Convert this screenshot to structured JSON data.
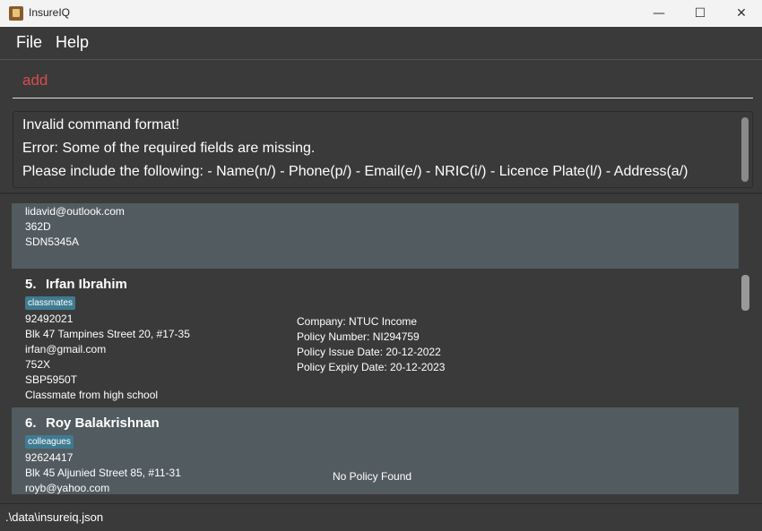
{
  "window": {
    "title": "InsureIQ",
    "minimize": "—",
    "maximize": "☐",
    "close": "✕"
  },
  "menu": {
    "file": "File",
    "help": "Help"
  },
  "command": {
    "value": "add"
  },
  "result": {
    "lines": [
      "Invalid command format!",
      "Error: Some of the required fields are missing.",
      "Please include the following: - Name(n/) - Phone(p/) - Email(e/) - NRIC(i/) - Licence Plate(l/) - Address(a/)"
    ]
  },
  "cards": [
    {
      "email": "lidavid@outlook.com",
      "nric": "362D",
      "plate": "SDN5345A"
    },
    {
      "index": "5.",
      "name": "Irfan Ibrahim",
      "tag": "classmates",
      "phone": "92492021",
      "address": "Blk 47 Tampines Street 20, #17-35",
      "email": "irfan@gmail.com",
      "nric": "752X",
      "plate": "SBP5950T",
      "remark": "Classmate from high school",
      "policy": {
        "company": "Company: NTUC Income",
        "number": "Policy Number: NI294759",
        "issue": "Policy Issue Date: 20-12-2022",
        "expiry": "Policy Expiry Date: 20-12-2023"
      }
    },
    {
      "index": "6.",
      "name": "Roy Balakrishnan",
      "tag": "colleagues",
      "phone": "92624417",
      "address": "Blk 45 Aljunied Street 85, #11-31",
      "email": "royb@yahoo.com",
      "policy_none": "No Policy Found"
    }
  ],
  "status": {
    "path": ".\\data\\insureiq.json"
  }
}
